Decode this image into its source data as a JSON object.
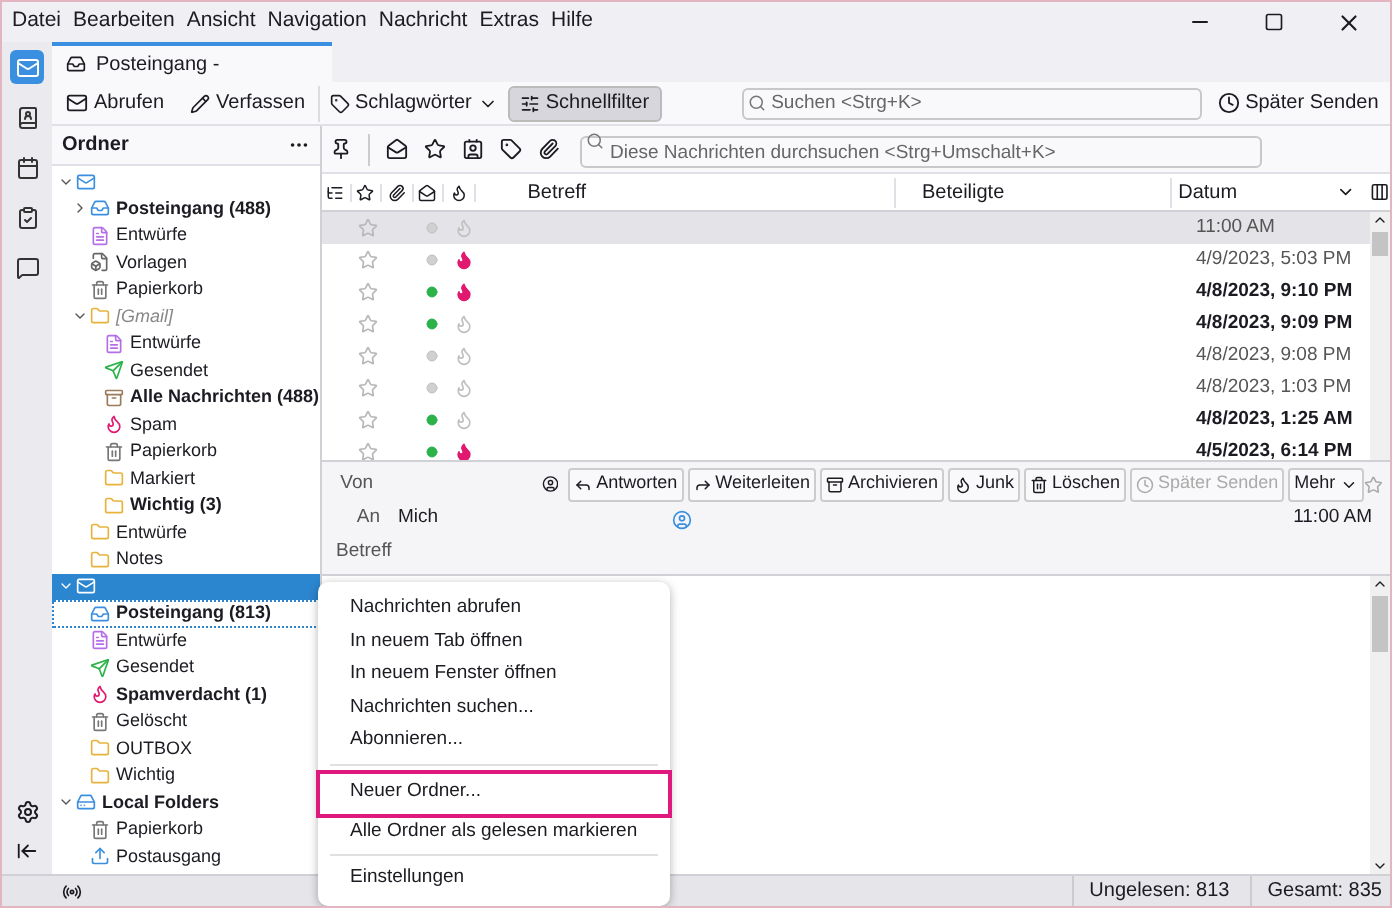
{
  "menu_bar": [
    "Datei",
    "Bearbeiten",
    "Ansicht",
    "Navigation",
    "Nachricht",
    "Extras",
    "Hilfe"
  ],
  "spaces": [
    {
      "kind": "mail",
      "selected": true
    },
    {
      "kind": "contacts",
      "selected": false
    },
    {
      "kind": "calendar",
      "selected": false
    },
    {
      "kind": "tasks",
      "selected": false
    },
    {
      "kind": "chat",
      "selected": false
    }
  ],
  "tab": {
    "title": "Posteingang -"
  },
  "toolbar": {
    "get_messages": "Abrufen",
    "compose": "Verfassen",
    "tags": "Schlagwörter",
    "quick_filter": {
      "label": "Schnellfilter",
      "pressed": true
    },
    "search": {
      "placeholder": "Suchen <Strg+K>"
    },
    "send_later": "Später Senden"
  },
  "folder_pane": {
    "title": "Ordner",
    "folders": [
      {
        "kind": "account",
        "expanded": true,
        "selected": false,
        "children": [
          {
            "kind": "inbox",
            "name": "Posteingang (488)",
            "unread": true,
            "expanded": false,
            "selected": false
          },
          {
            "kind": "drafts",
            "name": "Entwürfe",
            "unread": false,
            "selected": false
          },
          {
            "kind": "templates",
            "name": "Vorlagen",
            "unread": false,
            "selected": false
          },
          {
            "kind": "trash",
            "name": "Papierkorb",
            "unread": false,
            "selected": false
          },
          {
            "kind": "folder",
            "name": "[Gmail]",
            "unread": false,
            "virtual": true,
            "expanded": true,
            "selected": false,
            "children": [
              {
                "kind": "drafts",
                "name": "Entwürfe",
                "unread": false,
                "selected": false
              },
              {
                "kind": "sent",
                "name": "Gesendet",
                "unread": false,
                "selected": false
              },
              {
                "kind": "all",
                "name": "Alle Nachrichten (488)",
                "unread": true,
                "selected": false
              },
              {
                "kind": "spam",
                "name": "Spam",
                "unread": false,
                "selected": false
              },
              {
                "kind": "trash",
                "name": "Papierkorb",
                "unread": false,
                "selected": false
              },
              {
                "kind": "folder",
                "name": "Markiert",
                "unread": false,
                "selected": false
              },
              {
                "kind": "folder",
                "name": "Wichtig (3)",
                "unread": true,
                "selected": false
              }
            ]
          },
          {
            "kind": "folder",
            "name": "Entwürfe",
            "unread": false,
            "selected": false
          },
          {
            "kind": "folder",
            "name": "Notes",
            "unread": false,
            "selected": false
          }
        ]
      },
      {
        "kind": "account",
        "expanded": true,
        "selected": true,
        "children": [
          {
            "kind": "inbox",
            "name": "Posteingang (813)",
            "unread": true,
            "focused": true,
            "selected": false
          },
          {
            "kind": "drafts",
            "name": "Entwürfe",
            "unread": false,
            "selected": false
          },
          {
            "kind": "sent",
            "name": "Gesendet",
            "unread": false,
            "selected": false
          },
          {
            "kind": "spam",
            "name": "Spamverdacht (1)",
            "unread": true,
            "selected": false
          },
          {
            "kind": "trash",
            "name": "Gelöscht",
            "unread": false,
            "selected": false
          },
          {
            "kind": "folder",
            "name": "OUTBOX",
            "unread": false,
            "selected": false
          },
          {
            "kind": "folder",
            "name": "Wichtig",
            "unread": false,
            "selected": false
          }
        ]
      },
      {
        "kind": "local",
        "name": "Local Folders",
        "unread": true,
        "expanded": true,
        "selected": false,
        "children": [
          {
            "kind": "trash",
            "name": "Papierkorb",
            "unread": false,
            "selected": false
          },
          {
            "kind": "outbox",
            "name": "Postausgang",
            "unread": false,
            "selected": false
          }
        ]
      }
    ]
  },
  "quick_filter_bar": {
    "search": {
      "placeholder": "Diese Nachrichten durchsuchen <Strg+Umschalt+K>"
    }
  },
  "message_list": {
    "columns": [
      "Betreff",
      "Beteiligte",
      "Datum"
    ],
    "rows": [
      {
        "date": "11:00 AM",
        "selected": true,
        "unread": false,
        "starred": false,
        "junk": false
      },
      {
        "date": "4/9/2023, 5:03 PM",
        "selected": false,
        "unread": false,
        "starred": false,
        "junk": true
      },
      {
        "date": "4/8/2023, 9:10 PM",
        "selected": false,
        "unread": true,
        "starred": false,
        "junk": true
      },
      {
        "date": "4/8/2023, 9:09 PM",
        "selected": false,
        "unread": true,
        "starred": false,
        "junk": false
      },
      {
        "date": "4/8/2023, 9:08 PM",
        "selected": false,
        "unread": false,
        "starred": false,
        "junk": false
      },
      {
        "date": "4/8/2023, 1:03 PM",
        "selected": false,
        "unread": false,
        "starred": false,
        "junk": false
      },
      {
        "date": "4/8/2023, 1:25 AM",
        "selected": false,
        "unread": true,
        "starred": false,
        "junk": false
      },
      {
        "date": "4/5/2023, 6:14 PM",
        "selected": false,
        "unread": true,
        "starred": false,
        "junk": true
      }
    ]
  },
  "message_header": {
    "from_label": "Von",
    "buttons": [
      {
        "kind": "reply",
        "label": "Antworten",
        "disabled": false
      },
      {
        "kind": "forward",
        "label": "Weiterleiten",
        "disabled": false
      },
      {
        "kind": "archive",
        "label": "Archivieren",
        "disabled": false
      },
      {
        "kind": "junk",
        "label": "Junk",
        "disabled": false
      },
      {
        "kind": "delete",
        "label": "Löschen",
        "disabled": false
      },
      {
        "kind": "later",
        "label": "Später Senden",
        "disabled": true
      },
      {
        "kind": "more",
        "label": "Mehr",
        "disabled": false
      }
    ],
    "to_label": "An",
    "to": "Mich",
    "time": "11:00 AM",
    "subject_label": "Betreff"
  },
  "context_menu": {
    "items": [
      {
        "kind": "item",
        "label": "Nachrichten abrufen",
        "highlighted": false
      },
      {
        "kind": "item",
        "label": "In neuem Tab öffnen",
        "highlighted": false
      },
      {
        "kind": "item",
        "label": "In neuem Fenster öffnen",
        "highlighted": false
      },
      {
        "kind": "item",
        "label": "Nachrichten suchen...",
        "highlighted": false
      },
      {
        "kind": "item",
        "label": "Abonnieren...",
        "highlighted": false
      },
      {
        "kind": "separator"
      },
      {
        "kind": "item",
        "label": "Neuer Ordner...",
        "highlighted": true
      },
      {
        "kind": "item",
        "label": "Alle Ordner als gelesen markieren",
        "highlighted": false
      },
      {
        "kind": "separator"
      },
      {
        "kind": "item",
        "label": "Einstellungen",
        "highlighted": false
      }
    ]
  },
  "status_bar": {
    "unread": "Ungelesen: 813",
    "total": "Gesamt: 835"
  }
}
